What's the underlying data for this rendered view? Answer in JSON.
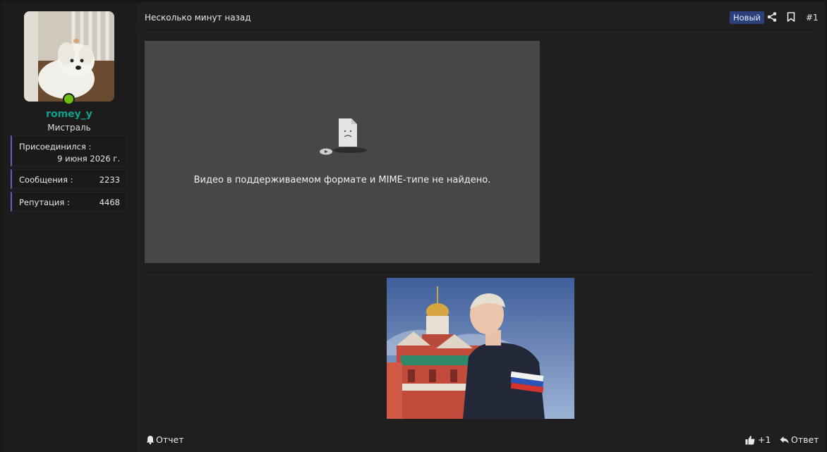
{
  "user": {
    "username": "romey_y",
    "title": "Мистраль",
    "stats": {
      "joined_label": "Присоединился :",
      "joined_value": "9 июня 2026 г.",
      "messages_label": "Сообщения :",
      "messages_value": "2233",
      "reputation_label": "Репутация :",
      "reputation_value": "4468"
    },
    "online_color": "#6bbf12",
    "username_color": "#12a08f"
  },
  "post": {
    "date": "Несколько минут назад",
    "badge": "Новый",
    "number": "#1",
    "video_error": "Видео в поддерживаемом формате и MIME-типе не найдено.",
    "icons": [
      "share-icon",
      "bookmark-icon",
      "bell-icon",
      "thumbs-up-icon",
      "reply-icon"
    ]
  },
  "footer": {
    "report_label": "Отчет",
    "like_label": "+1",
    "reply_label": "Ответ"
  },
  "colors": {
    "accent": "#5b63c8",
    "badge_bg": "#2b3f79"
  }
}
